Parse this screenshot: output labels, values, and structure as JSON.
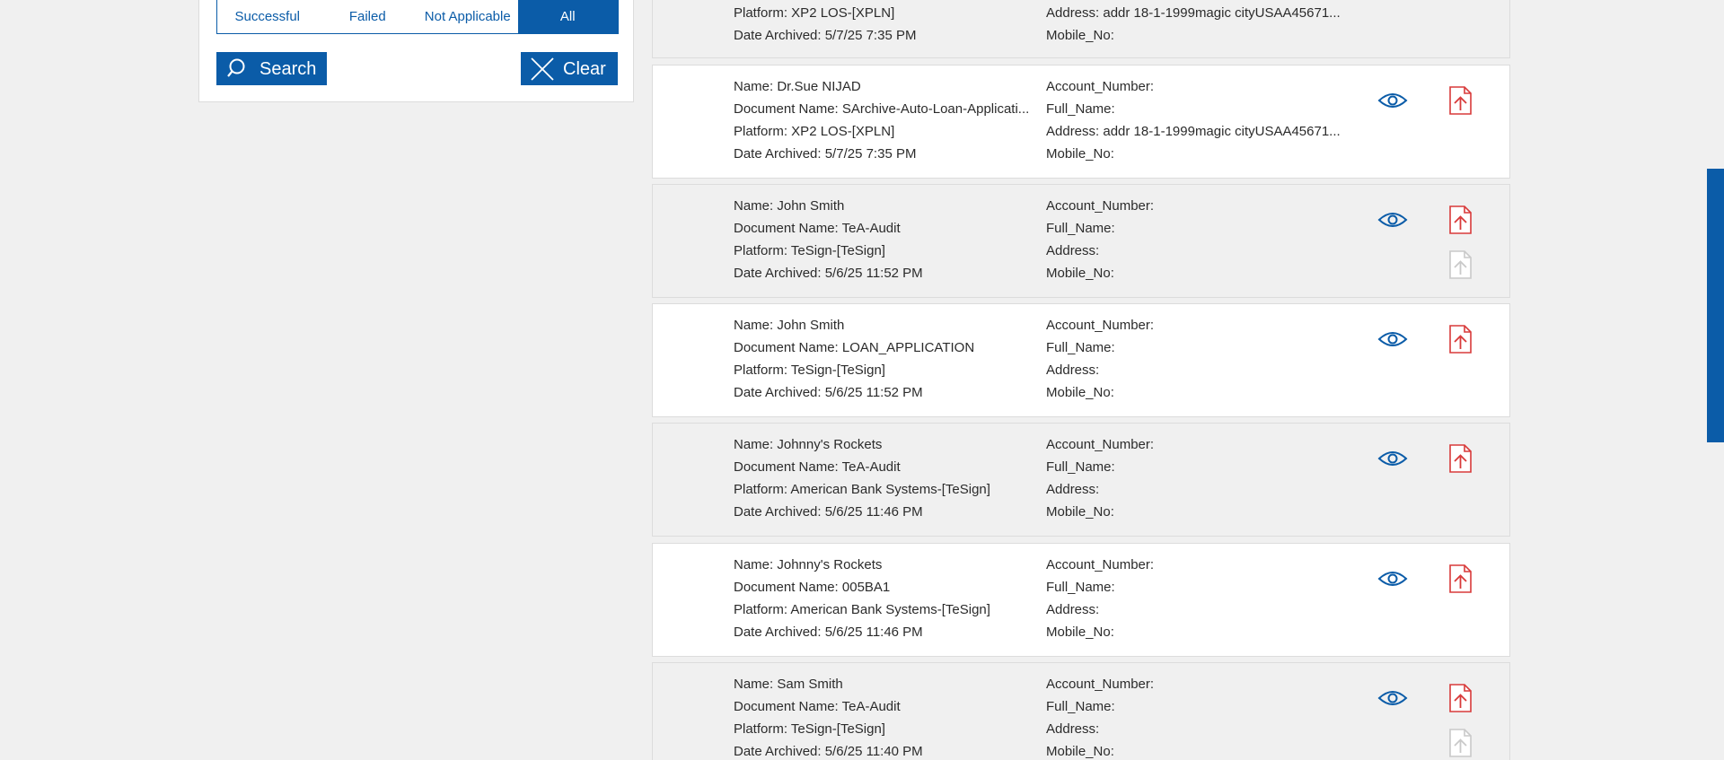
{
  "filter": {
    "status_options": [
      {
        "label": "Successful",
        "active": false
      },
      {
        "label": "Failed",
        "active": false
      },
      {
        "label": "Not Applicable",
        "active": false
      },
      {
        "label": "All",
        "active": true
      }
    ],
    "search_label": "Search",
    "clear_label": "Clear"
  },
  "colors": {
    "primary": "#0b5ca8",
    "pdf_red": "#d83a3a",
    "pdf_disabled": "#c9c9c9"
  },
  "records": [
    {
      "name": "",
      "document_name": "",
      "platform": "Platform: XP2 LOS-[XPLN]",
      "date_archived": "Date Archived: 5/7/25 7:35 PM",
      "account_number": "",
      "full_name": "",
      "address": "Address: addr 18-1-1999magic cityUSAA45671...",
      "mobile_no": "Mobile_No:",
      "has_secondary_pdf": false
    },
    {
      "name": "Name: Dr.Sue NIJAD",
      "document_name": "Document Name: SArchive-Auto-Loan-Applicati...",
      "platform": "Platform: XP2 LOS-[XPLN]",
      "date_archived": "Date Archived: 5/7/25 7:35 PM",
      "account_number": "Account_Number:",
      "full_name": "Full_Name:",
      "address": "Address: addr 18-1-1999magic cityUSAA45671...",
      "mobile_no": "Mobile_No:",
      "has_secondary_pdf": false
    },
    {
      "name": "Name: John Smith",
      "document_name": "Document Name: TeA-Audit",
      "platform": "Platform: TeSign-[TeSign]",
      "date_archived": "Date Archived: 5/6/25 11:52 PM",
      "account_number": "Account_Number:",
      "full_name": "Full_Name:",
      "address": "Address:",
      "mobile_no": "Mobile_No:",
      "has_secondary_pdf": true
    },
    {
      "name": "Name: John Smith",
      "document_name": "Document Name: LOAN_APPLICATION",
      "platform": "Platform: TeSign-[TeSign]",
      "date_archived": "Date Archived: 5/6/25 11:52 PM",
      "account_number": "Account_Number:",
      "full_name": "Full_Name:",
      "address": "Address:",
      "mobile_no": "Mobile_No:",
      "has_secondary_pdf": false
    },
    {
      "name": "Name: Johnny's Rockets",
      "document_name": "Document Name: TeA-Audit",
      "platform": "Platform: American Bank Systems-[TeSign]",
      "date_archived": "Date Archived: 5/6/25 11:46 PM",
      "account_number": "Account_Number:",
      "full_name": "Full_Name:",
      "address": "Address:",
      "mobile_no": "Mobile_No:",
      "has_secondary_pdf": false
    },
    {
      "name": "Name: Johnny's Rockets",
      "document_name": "Document Name: 005BA1",
      "platform": "Platform: American Bank Systems-[TeSign]",
      "date_archived": "Date Archived: 5/6/25 11:46 PM",
      "account_number": "Account_Number:",
      "full_name": "Full_Name:",
      "address": "Address:",
      "mobile_no": "Mobile_No:",
      "has_secondary_pdf": false
    },
    {
      "name": "Name: Sam Smith",
      "document_name": "Document Name: TeA-Audit",
      "platform": "Platform: TeSign-[TeSign]",
      "date_archived": "Date Archived: 5/6/25 11:40 PM",
      "account_number": "Account_Number:",
      "full_name": "Full_Name:",
      "address": "Address:",
      "mobile_no": "Mobile_No:",
      "has_secondary_pdf": true
    }
  ]
}
